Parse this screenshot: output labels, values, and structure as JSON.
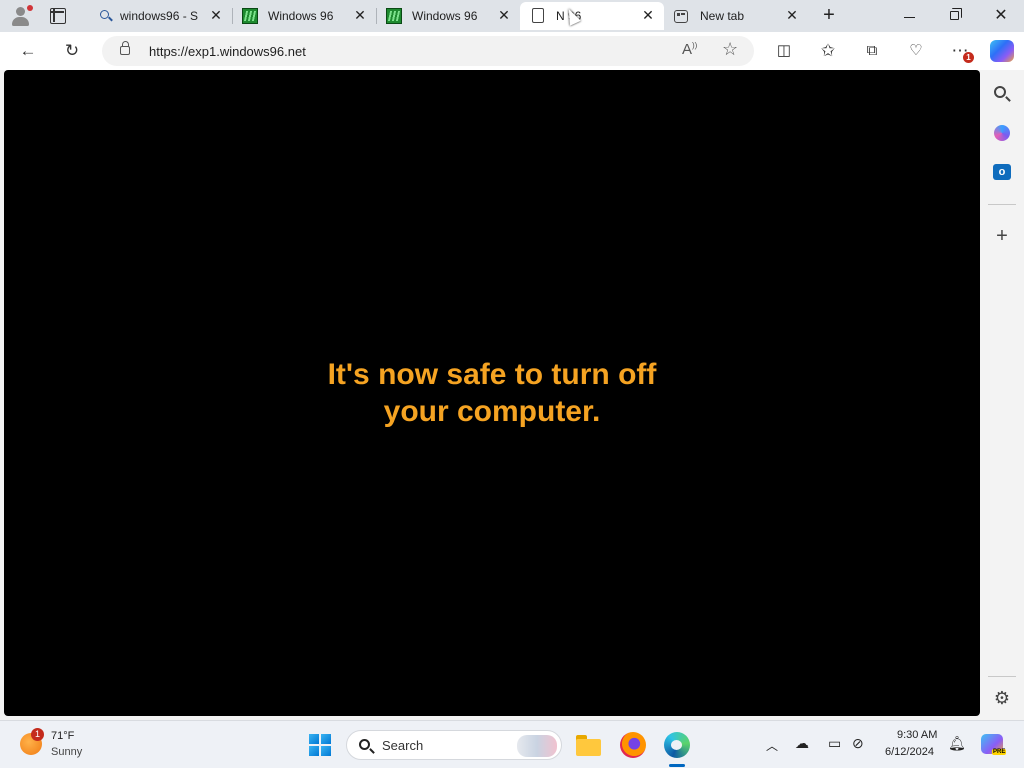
{
  "browser": {
    "tabs": [
      {
        "title": "windows96 - S",
        "favicon": "search-icon",
        "active": false
      },
      {
        "title": "Windows 96",
        "favicon": "windows96-icon",
        "active": false
      },
      {
        "title": "Windows 96",
        "favicon": "windows96-icon",
        "active": false
      },
      {
        "title": "N 96",
        "favicon": "page-icon",
        "active": true
      },
      {
        "title": "New tab",
        "favicon": "newtab-icon",
        "active": false
      }
    ],
    "address": {
      "url": "https://exp1.windows96.net"
    },
    "notification_count": "1"
  },
  "page": {
    "message_line1": "It's now safe to turn off",
    "message_line2": "your computer.",
    "text_color": "#f5a322",
    "background_color": "#000000"
  },
  "taskbar": {
    "weather": {
      "temperature": "71°F",
      "condition": "Sunny",
      "badge": "1"
    },
    "search_label": "Search",
    "clock": {
      "time": "9:30 AM",
      "date": "6/12/2024"
    },
    "copilot_badge": "PRE"
  }
}
